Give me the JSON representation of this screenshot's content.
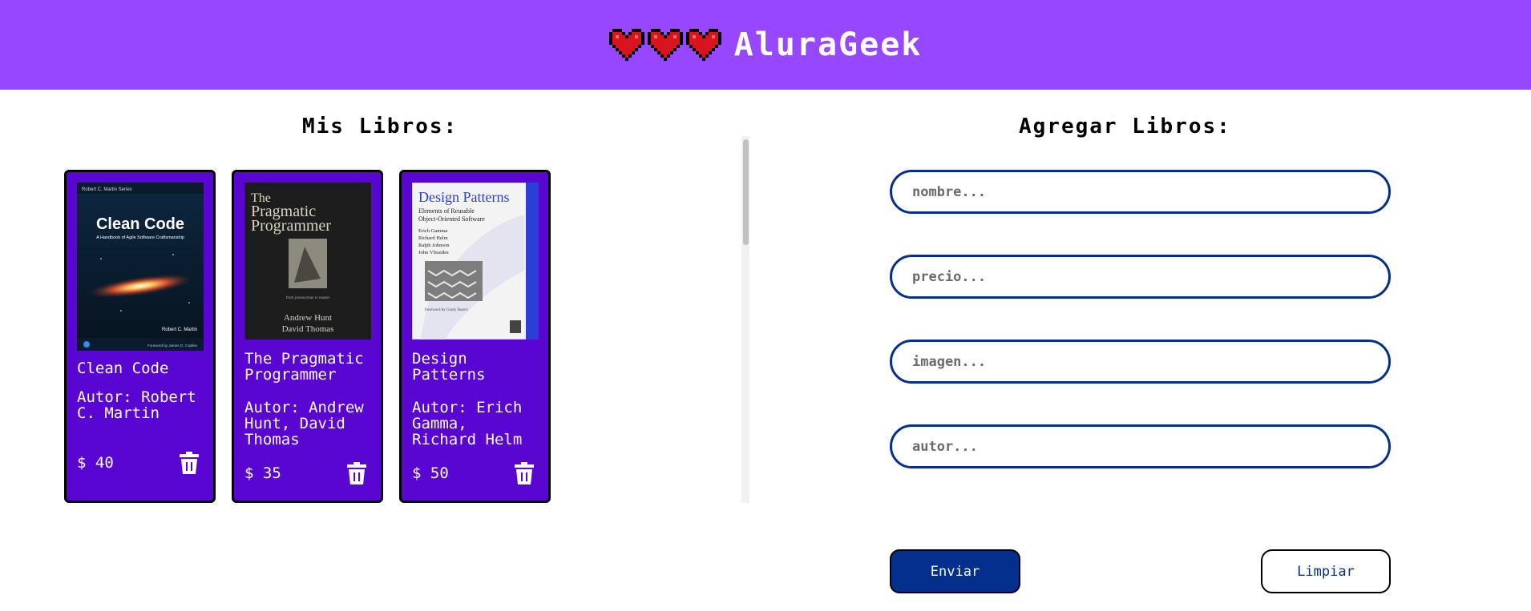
{
  "header": {
    "brand": "AluraGeek",
    "hearts": [
      "heart-icon",
      "heart-icon",
      "heart-icon"
    ],
    "brand_color": "#9747ff"
  },
  "products_section": {
    "title": "Mis Libros:",
    "items": [
      {
        "name": "Clean Code",
        "author": "Autor: Robert C. Martin",
        "price": "$ 40",
        "cover": {
          "series": "Robert C. Martin Series",
          "title": "Clean Code",
          "subtitle": "A Handbook of Agile Software Craftsmanship",
          "author": "Robert C. Martin",
          "foreword": "Foreword by James O. Coplien"
        }
      },
      {
        "name": "The Pragmatic Programmer",
        "author": "Autor: Andrew Hunt, David Thomas",
        "price": "$ 35",
        "cover": {
          "title_line1": "The",
          "title_line2": "Pragmatic",
          "title_line3": "Programmer",
          "tagline": "from journeyman to master",
          "author_line1": "Andrew Hunt",
          "author_line2": "David Thomas"
        }
      },
      {
        "name": "Design Patterns",
        "author": "Autor: Erich Gamma, Richard Helm",
        "price": "$ 50",
        "cover": {
          "title": "Design Patterns",
          "subtitle_line1": "Elements of Reusable",
          "subtitle_line2": "Object-Oriented Software",
          "authors": [
            "Erich Gamma",
            "Richard Helm",
            "Ralph Johnson",
            "John Vlissides"
          ],
          "foreword": "Foreword by Grady Booch"
        }
      }
    ]
  },
  "form_section": {
    "title": "Agregar Libros:",
    "fields": [
      {
        "placeholder": "nombre...",
        "value": ""
      },
      {
        "placeholder": "precio...",
        "value": ""
      },
      {
        "placeholder": "imagen...",
        "value": ""
      },
      {
        "placeholder": "autor...",
        "value": ""
      }
    ],
    "submit_label": "Enviar",
    "clear_label": "Limpiar"
  },
  "colors": {
    "card_bg": "#5a06d3",
    "accent_blue": "#042f8d"
  }
}
